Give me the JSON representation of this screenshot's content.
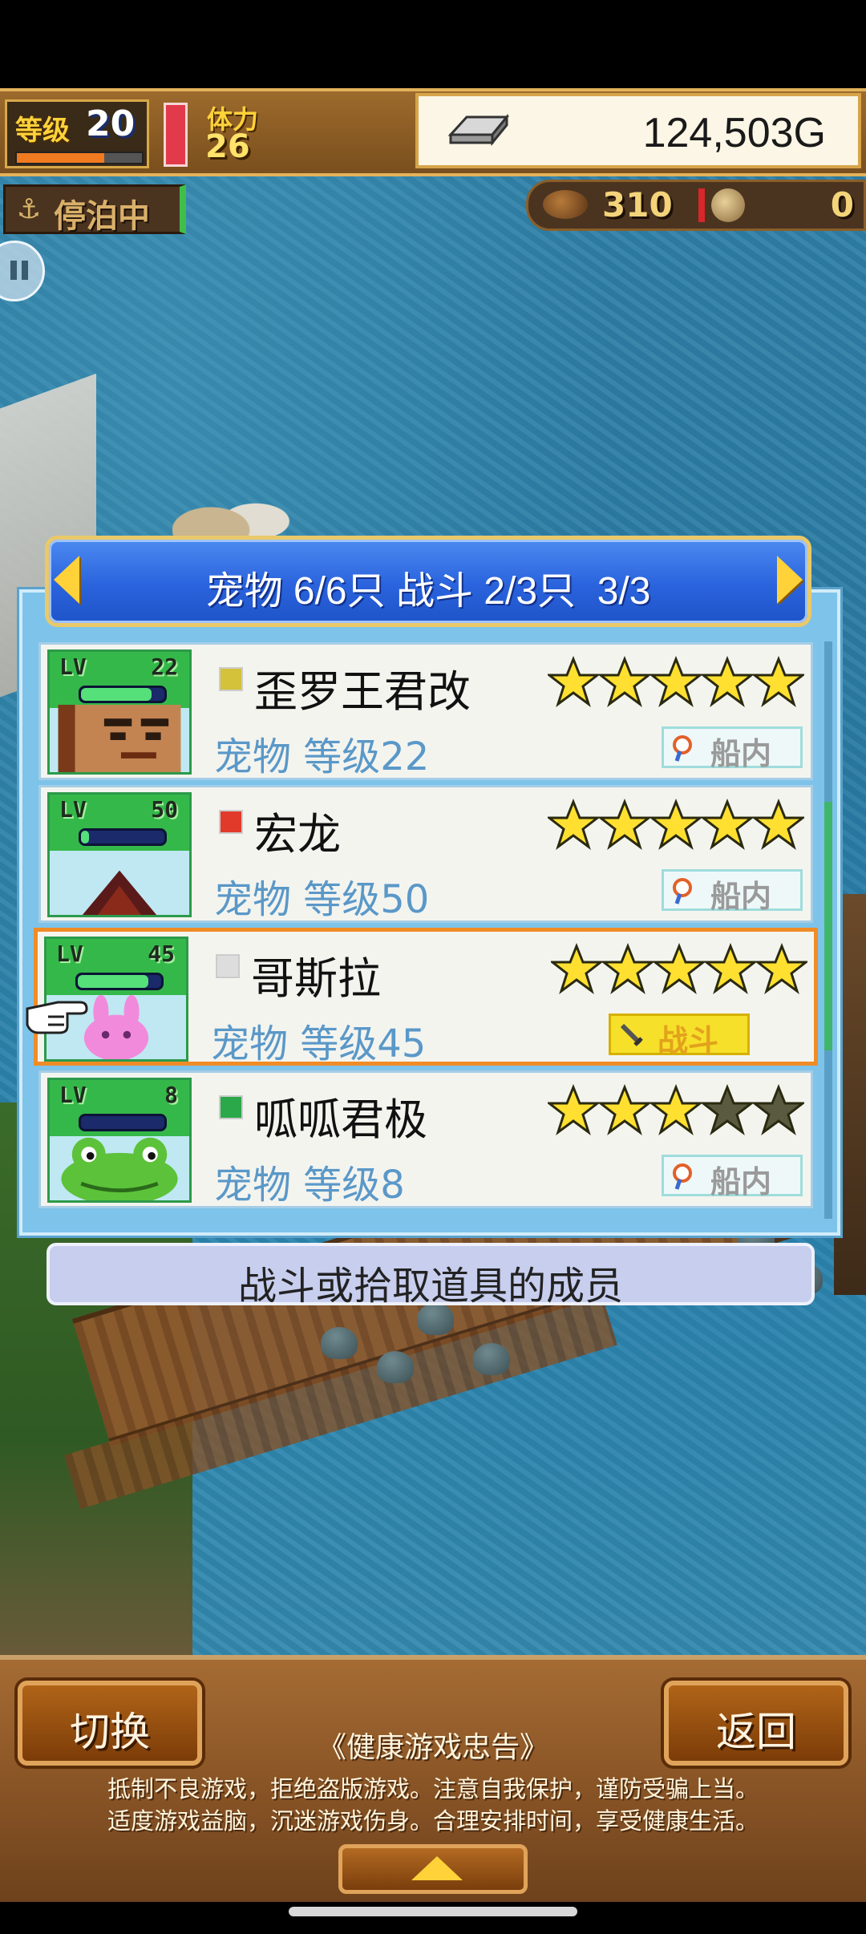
{
  "hud": {
    "level_label": "等级",
    "level_value": "20",
    "stamina_label": "体力",
    "stamina_value": "26",
    "gold_value": "124,503G",
    "dock_status": "停泊中",
    "food_value": "310",
    "coin_value": "0"
  },
  "panel": {
    "header_title": "宠物 6/6只 战斗 2/3只  3/3",
    "footer_label": "战斗或拾取道具的成员"
  },
  "pets": [
    {
      "lv_label": "LV",
      "level": "22",
      "name": "歪罗王君改",
      "type_level": "宠物 等级22",
      "status": "船内",
      "stars_filled": 5,
      "stars_total": 5,
      "hp_fraction": 0.85,
      "element_color": "#d4c23a",
      "selected": false
    },
    {
      "lv_label": "LV",
      "level": "50",
      "name": "宏龙",
      "type_level": "宠物 等级50",
      "status": "船内",
      "stars_filled": 5,
      "stars_total": 5,
      "hp_fraction": 0.1,
      "element_color": "#e23a2a",
      "selected": false
    },
    {
      "lv_label": "LV",
      "level": "45",
      "name": "哥斯拉",
      "type_level": "宠物 等级45",
      "status": "战斗",
      "stars_filled": 5,
      "stars_total": 5,
      "hp_fraction": 0.85,
      "element_color": "#dddddd",
      "selected": true
    },
    {
      "lv_label": "LV",
      "level": "8",
      "name": "呱呱君极",
      "type_level": "宠物 等级8",
      "status": "船内",
      "stars_filled": 3,
      "stars_total": 5,
      "hp_fraction": 0.0,
      "element_color": "#2aa84a",
      "selected": false
    }
  ],
  "bottom": {
    "switch_label": "切换",
    "back_label": "返回",
    "advisory_title": "《健康游戏忠告》",
    "advisory_line_1": "抵制不良游戏，拒绝盗版游戏。注意自我保护，谨防受骗上当。",
    "advisory_line_2": "适度游戏益脑，沉迷游戏伤身。合理安排时间，享受健康生活。"
  },
  "colors": {
    "accent_blue": "#2a63dd",
    "selected_border": "#f08c26",
    "star_gold": "#ffe030",
    "star_empty": "#5a5a40"
  },
  "icons": {
    "gold": "silver-bar-icon",
    "dock": "anchor-icon",
    "food": "bread-icon",
    "coin": "coin-icon",
    "status_in_ship": "magnifier-icon",
    "status_battle": "sword-icon",
    "pointer": "pointing-hand-icon"
  }
}
